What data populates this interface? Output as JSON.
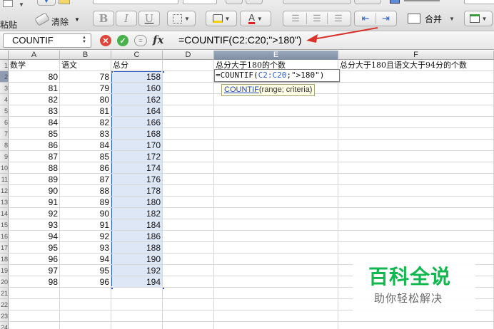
{
  "ribbon": {
    "paste_label": "粘贴",
    "clear_label": "清除",
    "bold": "B",
    "italic": "I",
    "underline": "U",
    "merge_label": "合并"
  },
  "formula_bar": {
    "name_box": "COUNTIF",
    "name_box_arrow": "▲▼",
    "cancel_symbol": "✕",
    "confirm_symbol": "✓",
    "fx_label": "fx",
    "formula": "=COUNTIF(C2:C20;\">180\")"
  },
  "columns": [
    {
      "label": "A",
      "active": false
    },
    {
      "label": "B",
      "active": false
    },
    {
      "label": "C",
      "active": false
    },
    {
      "label": "D",
      "active": false
    },
    {
      "label": "E",
      "active": true
    },
    {
      "label": "F",
      "active": false
    }
  ],
  "header_row": {
    "a": "数学",
    "b": "语文",
    "c": "总分",
    "e": "总分大于180的个数",
    "f": "总分大于180且语文大于94分的个数"
  },
  "rows": [
    {
      "a": "80",
      "b": "78",
      "c": "158"
    },
    {
      "a": "81",
      "b": "79",
      "c": "160"
    },
    {
      "a": "82",
      "b": "80",
      "c": "162"
    },
    {
      "a": "83",
      "b": "81",
      "c": "164"
    },
    {
      "a": "84",
      "b": "82",
      "c": "166"
    },
    {
      "a": "85",
      "b": "83",
      "c": "168"
    },
    {
      "a": "86",
      "b": "84",
      "c": "170"
    },
    {
      "a": "87",
      "b": "85",
      "c": "172"
    },
    {
      "a": "88",
      "b": "86",
      "c": "174"
    },
    {
      "a": "89",
      "b": "87",
      "c": "176"
    },
    {
      "a": "90",
      "b": "88",
      "c": "178"
    },
    {
      "a": "91",
      "b": "89",
      "c": "180"
    },
    {
      "a": "92",
      "b": "90",
      "c": "182"
    },
    {
      "a": "93",
      "b": "91",
      "c": "184"
    },
    {
      "a": "94",
      "b": "92",
      "c": "186"
    },
    {
      "a": "95",
      "b": "93",
      "c": "188"
    },
    {
      "a": "96",
      "b": "94",
      "c": "190"
    },
    {
      "a": "97",
      "b": "95",
      "c": "192"
    },
    {
      "a": "98",
      "b": "96",
      "c": "194"
    }
  ],
  "row_numbers": [
    "1",
    "2",
    "3",
    "4",
    "5",
    "6",
    "7",
    "8",
    "9",
    "10",
    "11",
    "12",
    "13",
    "14",
    "15",
    "16",
    "17",
    "18",
    "19",
    "20",
    "21",
    "22",
    "23",
    "24"
  ],
  "edit_cell": {
    "prefix": "=COUNTIF(",
    "ref": "C2:C20",
    "suffix": ";\">180\")"
  },
  "tooltip": {
    "fn": "COUNTIF",
    "args": "(range; criteria)"
  },
  "watermark": {
    "title": "百科全说",
    "subtitle": "助你轻松解决"
  },
  "colors": {
    "arrow": "#d9322b",
    "selection_border": "#3060c0",
    "cancel": "#e0453a",
    "confirm": "#47b24a",
    "watermark_green": "#12b84f"
  }
}
